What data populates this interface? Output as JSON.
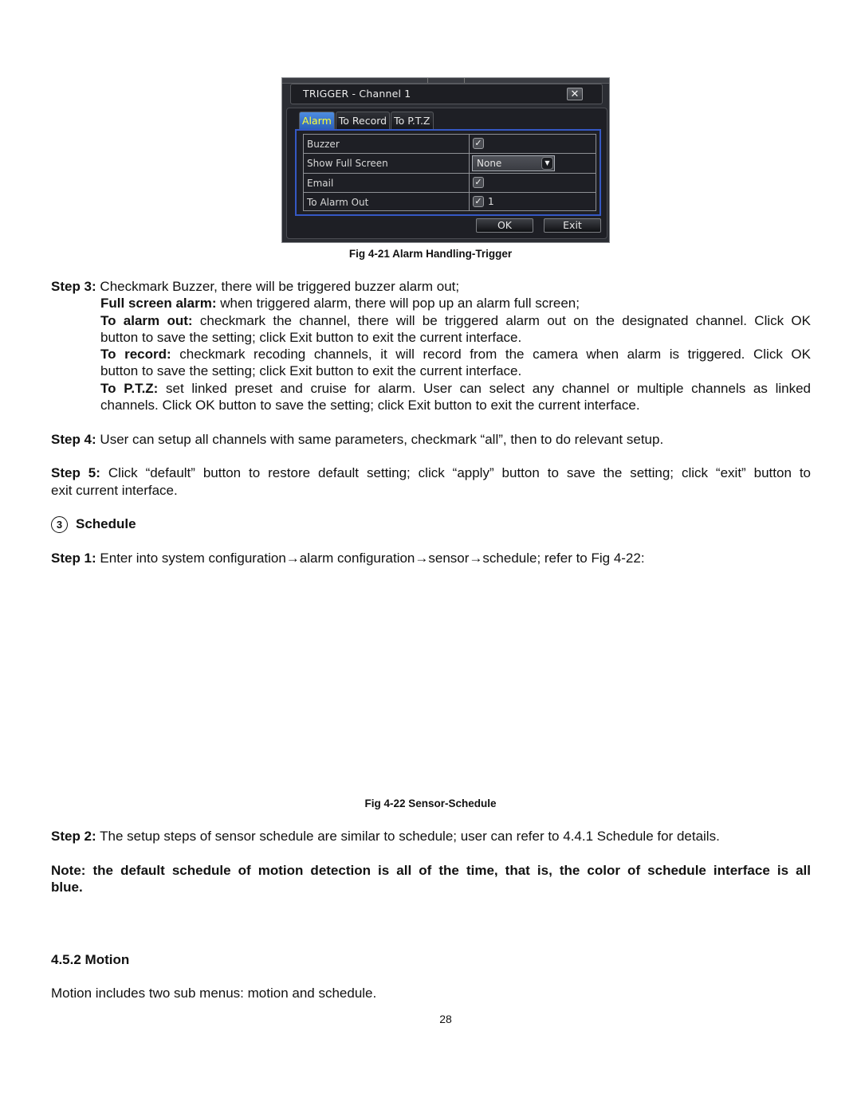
{
  "figure_4_21": {
    "dialog": {
      "title": "TRIGGER - Channel 1",
      "close_glyph": "✕",
      "tabs": [
        {
          "label": "Alarm",
          "active": true
        },
        {
          "label": "To Record",
          "active": false
        },
        {
          "label": "To P.T.Z",
          "active": false
        }
      ],
      "rows": [
        {
          "label": "Buzzer",
          "type": "checkbox",
          "checked": true,
          "value": ""
        },
        {
          "label": "Show Full Screen",
          "type": "select",
          "value": "None"
        },
        {
          "label": "Email",
          "type": "checkbox",
          "checked": true,
          "value": ""
        },
        {
          "label": "To Alarm Out",
          "type": "checkbox",
          "checked": true,
          "value": "1"
        }
      ],
      "check_glyph": "✓",
      "dropdown_glyph": "▼",
      "ok_label": "OK",
      "exit_label": "Exit",
      "colors": {
        "active_tab": "#2f6fd0",
        "active_tab_text": "#ffff33",
        "panel_border": "#3558c4",
        "background": "#1e1f25"
      }
    },
    "caption": "Fig 4-21 Alarm Handling-Trigger"
  },
  "step3": {
    "label": "Step 3:",
    "text": " Checkmark Buzzer, there will be triggered buzzer alarm out;",
    "full_screen": {
      "label": "Full screen alarm:",
      "text": " when triggered alarm, there will pop up an alarm full screen;"
    },
    "alarm_out": {
      "label": "To alarm out:",
      "line1": " checkmark the channel, there will be triggered alarm out on the designated channel. Click OK",
      "line2": "button to save the setting; click Exit button to exit the current interface."
    },
    "record": {
      "label": "To record:",
      "line1": " checkmark recoding channels, it will record from the camera when alarm is triggered. Click OK",
      "line2": "button to save the setting; click Exit button to exit the current interface."
    },
    "ptz": {
      "label": "To P.T.Z:",
      "line1": " set linked preset and cruise for alarm. User can select any channel or multiple channels as linked",
      "line2": "channels. Click OK button to save the setting; click Exit button to exit the current interface."
    }
  },
  "step4": {
    "label": "Step 4:",
    "text": " User can setup all channels with same parameters, checkmark “all”, then to do relevant setup."
  },
  "step5": {
    "label": "Step 5:",
    "line1": " Click “default” button to restore default setting; click “apply” button to save the setting; click “exit” button to",
    "line2": "exit current interface."
  },
  "schedule_section": {
    "number": "3",
    "title": "Schedule"
  },
  "schedule_step1": {
    "label": "Step 1:",
    "text": " Enter into system configuration→alarm configuration→sensor→schedule; refer to Fig 4-22:"
  },
  "figure_4_22": {
    "caption": "Fig 4-22 Sensor-Schedule"
  },
  "schedule_step2": {
    "label": "Step 2:",
    "text": " The setup steps of sensor schedule are similar to schedule; user can refer to 4.4.1 Schedule for details."
  },
  "note": {
    "line1": "Note: the default schedule of motion detection is all of the time, that is, the color of schedule interface is all",
    "line2": "blue."
  },
  "motion_section": {
    "title": "4.5.2 Motion",
    "text": "Motion includes two sub menus: motion and schedule."
  },
  "page_number": "28"
}
